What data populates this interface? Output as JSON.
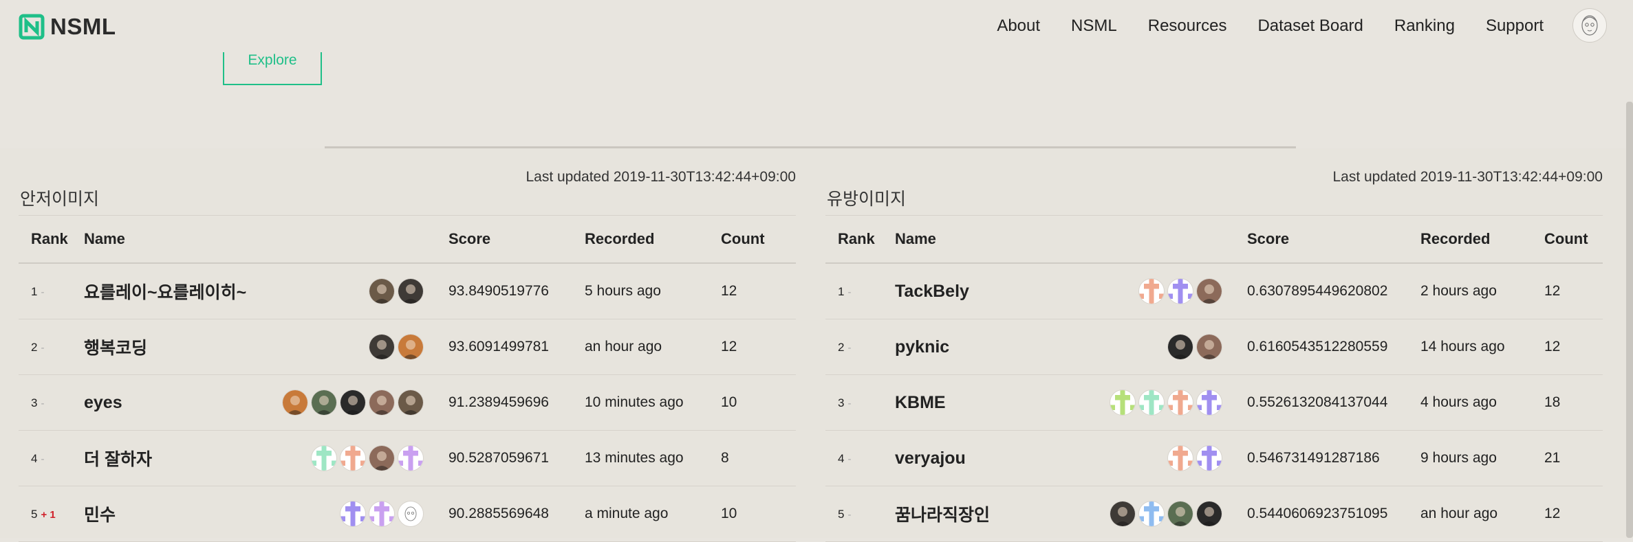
{
  "nav": {
    "brand": "NSML",
    "items": [
      "About",
      "NSML",
      "Resources",
      "Dataset Board",
      "Ranking",
      "Support"
    ]
  },
  "hero": {
    "explore_label": "Explore"
  },
  "colors": {
    "accent": "#1fbf88",
    "rank_up": "#d0202a",
    "background": "#e8e5df"
  },
  "columns": {
    "rank": "Rank",
    "name": "Name",
    "score": "Score",
    "recorded": "Recorded",
    "count": "Count"
  },
  "boards": [
    {
      "title": "안저이미지",
      "updated": "Last updated 2019-11-30T13:42:44+09:00",
      "rows": [
        {
          "rank": "1",
          "change": "-",
          "name": "요를레이~요를레이히~",
          "score": "93.8490519776",
          "recorded": "5 hours ago",
          "count": "12",
          "avatars": [
            "photo-avatar",
            "photo-avatar"
          ]
        },
        {
          "rank": "2",
          "change": "-",
          "name": "행복코딩",
          "score": "93.6091499781",
          "recorded": "an hour ago",
          "count": "12",
          "avatars": [
            "photo-avatar",
            "photo-avatar"
          ]
        },
        {
          "rank": "3",
          "change": "-",
          "name": "eyes",
          "score": "91.2389459696",
          "recorded": "10 minutes ago",
          "count": "10",
          "avatars": [
            "photo-avatar",
            "photo-avatar",
            "photo-avatar",
            "photo-avatar",
            "photo-avatar"
          ]
        },
        {
          "rank": "4",
          "change": "-",
          "name": "더 잘하자",
          "score": "90.5287059671",
          "recorded": "13 minutes ago",
          "count": "8",
          "avatars": [
            "identicon-avatar",
            "identicon-avatar",
            "photo-avatar",
            "identicon-avatar"
          ]
        },
        {
          "rank": "5",
          "change": "+ 1",
          "name": "민수",
          "score": "90.2885569648",
          "recorded": "a minute ago",
          "count": "10",
          "avatars": [
            "identicon-avatar",
            "identicon-avatar",
            "sketch-avatar"
          ]
        }
      ]
    },
    {
      "title": "유방이미지",
      "updated": "Last updated 2019-11-30T13:42:44+09:00",
      "rows": [
        {
          "rank": "1",
          "change": "-",
          "name": "TackBely",
          "score": "0.6307895449620802",
          "recorded": "2 hours ago",
          "count": "12",
          "avatars": [
            "identicon-avatar",
            "identicon-avatar",
            "photo-avatar"
          ]
        },
        {
          "rank": "2",
          "change": "-",
          "name": "pyknic",
          "score": "0.6160543512280559",
          "recorded": "14 hours ago",
          "count": "12",
          "avatars": [
            "photo-avatar",
            "photo-avatar"
          ]
        },
        {
          "rank": "3",
          "change": "-",
          "name": "KBME",
          "score": "0.5526132084137044",
          "recorded": "4 hours ago",
          "count": "18",
          "avatars": [
            "identicon-avatar",
            "identicon-avatar",
            "identicon-avatar",
            "identicon-avatar"
          ]
        },
        {
          "rank": "4",
          "change": "-",
          "name": "veryajou",
          "score": "0.546731491287186",
          "recorded": "9 hours ago",
          "count": "21",
          "avatars": [
            "identicon-avatar",
            "identicon-avatar"
          ]
        },
        {
          "rank": "5",
          "change": "-",
          "name": "꿈나라직장인",
          "score": "0.5440606923751095",
          "recorded": "an hour ago",
          "count": "12",
          "avatars": [
            "photo-avatar",
            "identicon-avatar",
            "photo-avatar",
            "photo-avatar"
          ]
        }
      ]
    }
  ]
}
